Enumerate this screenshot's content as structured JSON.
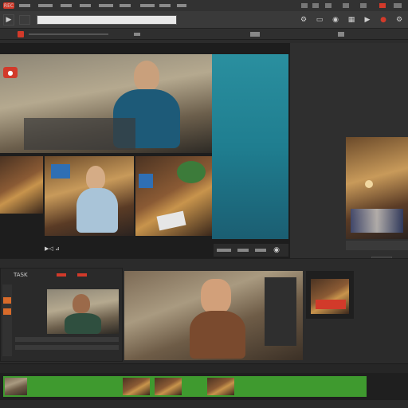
{
  "menubar": {
    "recording_label": "REC"
  },
  "toolbar": {
    "playback_label": "▶"
  },
  "viewer": {
    "top_badge": "●"
  },
  "lower_toolbar": {
    "label": "▶◁ ⊿"
  },
  "bottom_panel": {
    "header_label": "TASK"
  },
  "right_panel": {
    "small_button": "▣"
  },
  "colors": {
    "accent_red": "#d23a2a",
    "timeline_green": "#3f9a2f",
    "panel_bg": "#2b2b2b"
  },
  "icons": [
    "gear-icon",
    "monitor-icon",
    "camera-icon",
    "record-icon",
    "play-icon",
    "grid-icon"
  ]
}
